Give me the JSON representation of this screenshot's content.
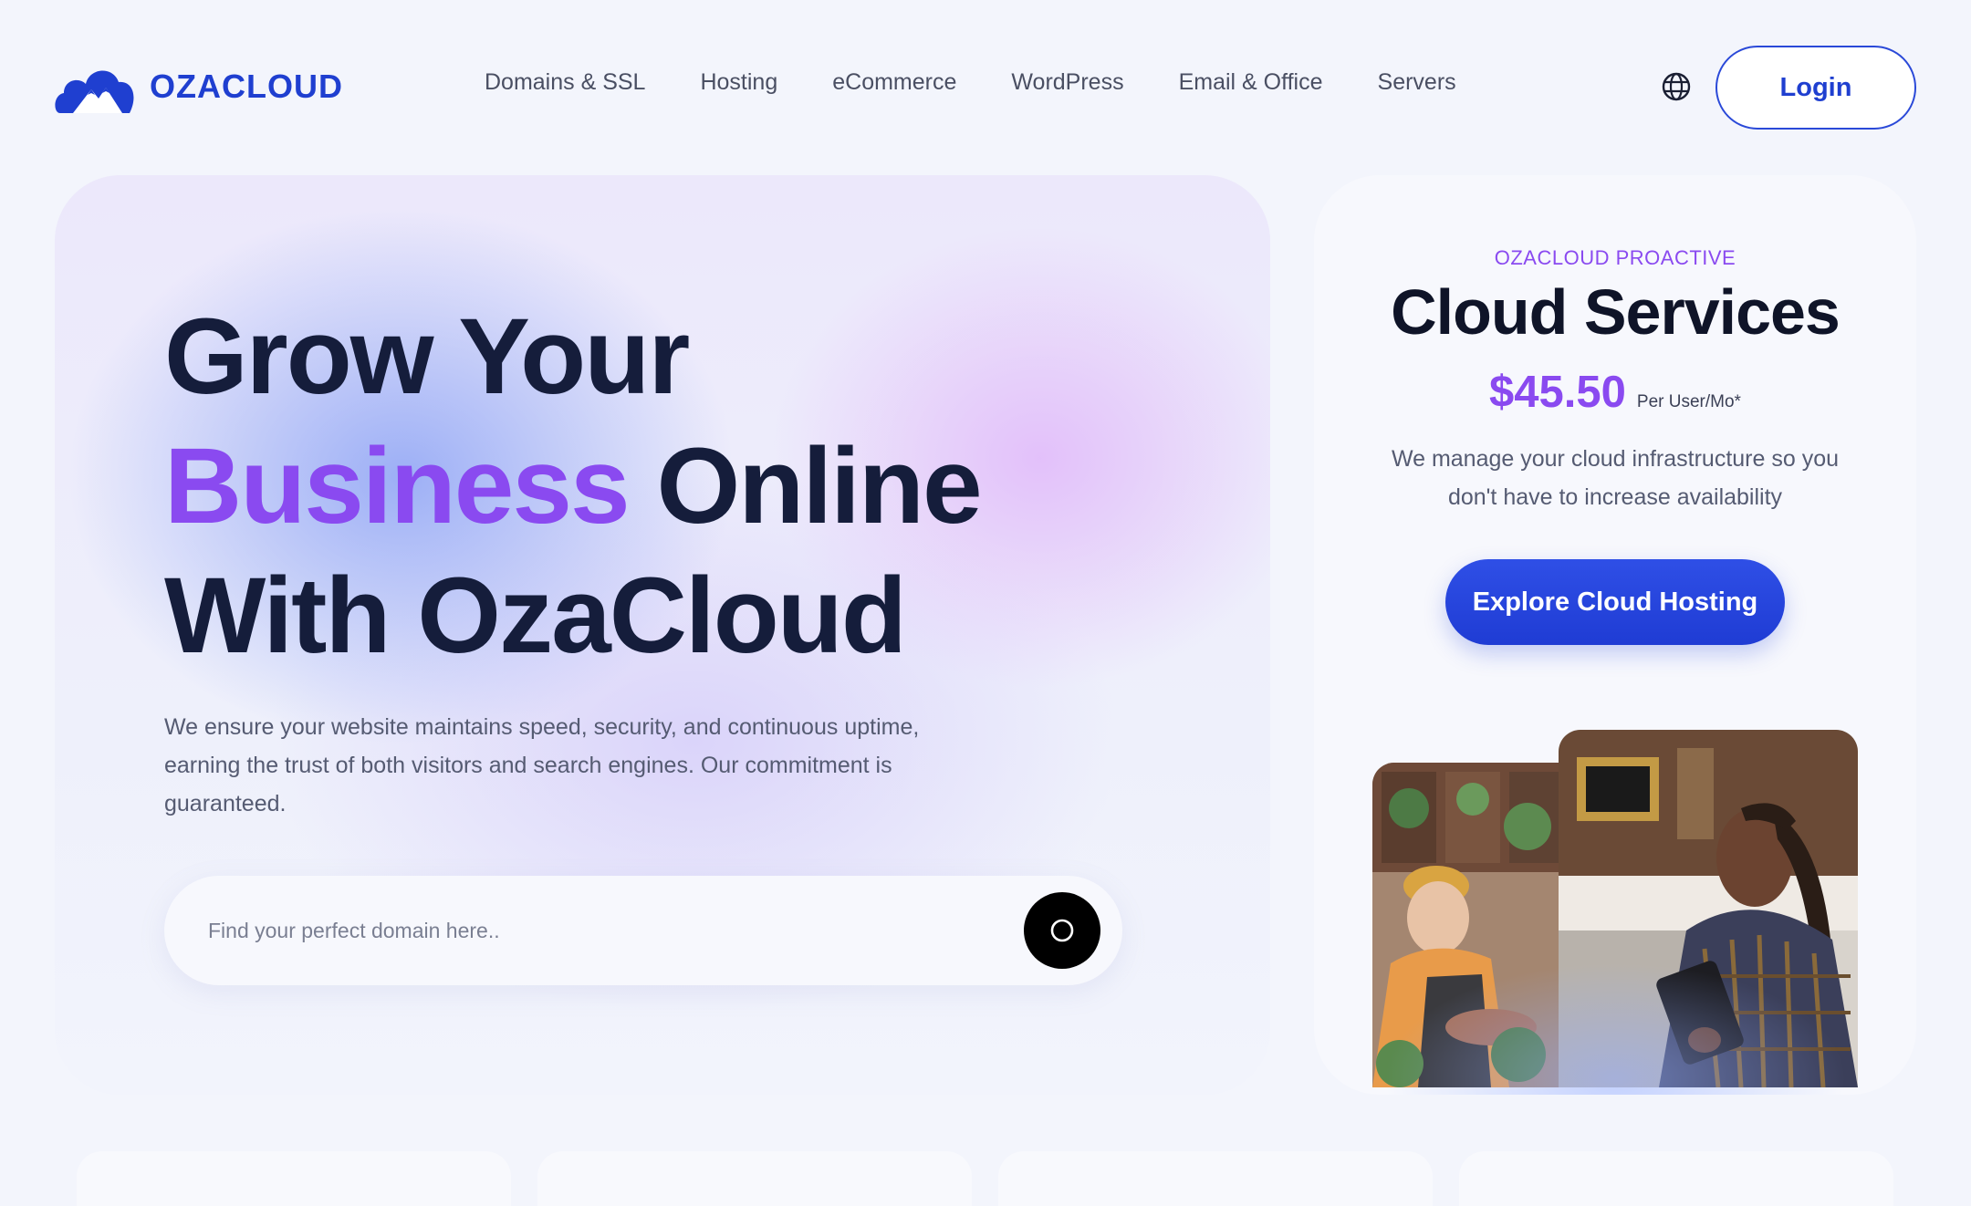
{
  "brand": {
    "name": "OZACLOUD",
    "color": "#1f3fd0",
    "accent": "#8a4af0"
  },
  "nav": {
    "items": [
      {
        "label": "Domains & SSL"
      },
      {
        "label": "Hosting"
      },
      {
        "label": "eCommerce"
      },
      {
        "label": "WordPress"
      },
      {
        "label": "Email & Office"
      },
      {
        "label": "Servers"
      }
    ],
    "globe_icon": "globe-icon",
    "login_label": "Login"
  },
  "hero": {
    "title_line1": "Grow Your",
    "title_line2_accent": "Business",
    "title_line2_rest": " Online",
    "title_line3": "With OzaCloud",
    "description": "We ensure your website maintains speed, security, and continuous uptime, earning the trust of both visitors and search engines. Our commitment is guaranteed.",
    "search": {
      "placeholder": "Find your perfect domain here..",
      "value": "",
      "button_icon": "search-icon"
    }
  },
  "promo": {
    "eyebrow": "OZACLOUD PROACTIVE",
    "title": "Cloud Services",
    "price": "$45.50",
    "price_unit": "Per User/Mo*",
    "description": "We manage your cloud infrastructure so you don't have to increase availability",
    "cta_label": "Explore Cloud Hosting"
  }
}
